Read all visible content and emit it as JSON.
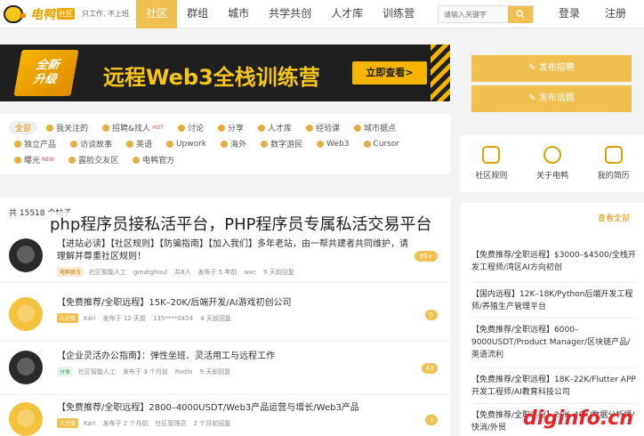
{
  "header": {
    "logo_text": "电鸭",
    "logo_badge": "社区",
    "slogan": "只工作, 不上班",
    "nav": [
      "社区",
      "群组",
      "城市",
      "共学共创",
      "人才库",
      "训练营"
    ],
    "search_placeholder": "请输入关键字",
    "login": "登录",
    "register": "注册",
    "colors": {
      "accent": "#f0c050",
      "brand": "#e8a400"
    }
  },
  "banner": {
    "tag_line1": "全新",
    "tag_line2": "升级",
    "title": "远程Web3全栈训练营",
    "button": "立即查看>"
  },
  "tags": [
    {
      "label": "全部",
      "active": true
    },
    {
      "label": "我关注的"
    },
    {
      "label": "招聘&找人",
      "badge": "HOT"
    },
    {
      "label": "讨论"
    },
    {
      "label": "分享"
    },
    {
      "label": "人才库"
    },
    {
      "label": "经验课"
    },
    {
      "label": "城市据点"
    },
    {
      "label": "独立产品"
    },
    {
      "label": "访谈故事"
    },
    {
      "label": "英语"
    },
    {
      "label": "Upwork"
    },
    {
      "label": "海外"
    },
    {
      "label": "数字游民"
    },
    {
      "label": "Web3"
    },
    {
      "label": "Cursor"
    },
    {
      "label": "曝光",
      "badge": "NEW"
    },
    {
      "label": "露脸交友区"
    },
    {
      "label": "电鸭官方"
    }
  ],
  "posts_count": "共 15518 个帖子",
  "overlay_title": "php程序员接私活平台，PHP程序员专属私活交易平台",
  "posts": [
    {
      "title": "【进站必读】【社区规则】【防骗指南】【加入我们】多年老站，由一帮共建者共同维护，请理解并尊重社区规则！",
      "tag": "电鸭官方",
      "meta": [
        "社区智能人工",
        "greatghoul",
        "共8人",
        "发布于 5 年前",
        "wxc",
        "9 天前回复"
      ],
      "replies": "99+"
    },
    {
      "title": "【免费推荐/全职远程】15K–20K/后端开发/AI游戏初创公司",
      "tag": "人才库",
      "meta": [
        "Kari",
        "发布于 12 天前",
        "135****0424",
        "4 天前回复"
      ],
      "replies": "5"
    },
    {
      "title": "【企业灵活办公指南】：弹性坐班、灵活用工与远程工作",
      "tag": "分享",
      "meta": [
        "社区智能人工",
        "发布于 3 个月前",
        "Rodin",
        "9 天前回复"
      ],
      "replies": "43"
    },
    {
      "title": "【免费推荐/全职远程】2800–4000USDT/Web3产品运营与增长/Web3产品",
      "tag": "人才库",
      "meta": [
        "Kari",
        "发布于 2 个月前",
        "社区管理员",
        "2 个月前回复"
      ],
      "replies": "3"
    }
  ],
  "sidebar": {
    "post_job": "发布招聘",
    "post_topic": "发布话题",
    "links": [
      "社区规则",
      "关于电鸭",
      "我的简历"
    ],
    "jobs_more": "查看全部",
    "jobs": [
      "【免费推荐/全职远程】$3000–$4500/全栈开发工程师/湾区AI方向初创",
      "【国内远程】12K–18K/Python后端开发工程师/养殖生产管理平台",
      "【免费推荐/全职远程】6000–9000USDT/Product Manager/区块链产品/英语流利",
      "【免费推荐/全职远程】18K–22K/Flutter APP 开发工程师/AI教育科技公司",
      "【免费推荐/全职远程】20K–40K/数据分析师/快消/外贸"
    ]
  },
  "watermark": "diginfo.cn"
}
